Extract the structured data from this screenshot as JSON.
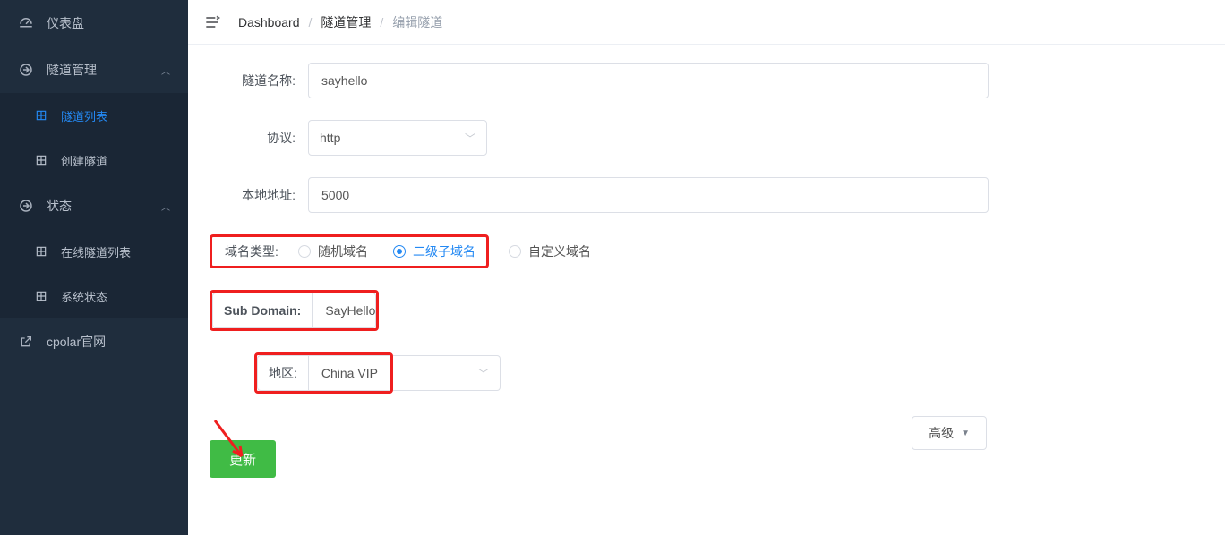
{
  "sidebar": {
    "items": [
      {
        "icon": "dashboard-icon",
        "label": "仪表盘",
        "type": "item"
      },
      {
        "icon": "circle-arrow-icon",
        "label": "隧道管理",
        "type": "group",
        "expanded": true,
        "children": [
          {
            "icon": "grid-icon",
            "label": "隧道列表",
            "active": true
          },
          {
            "icon": "grid-icon",
            "label": "创建隧道",
            "active": false
          }
        ]
      },
      {
        "icon": "circle-arrow-icon",
        "label": "状态",
        "type": "group",
        "expanded": true,
        "children": [
          {
            "icon": "grid-icon",
            "label": "在线隧道列表",
            "active": false
          },
          {
            "icon": "grid-icon",
            "label": "系统状态",
            "active": false
          }
        ]
      },
      {
        "icon": "external-link-icon",
        "label": "cpolar官网",
        "type": "item"
      }
    ]
  },
  "breadcrumb": {
    "items": [
      {
        "label": "Dashboard",
        "link": true
      },
      {
        "label": "隧道管理",
        "link": true
      },
      {
        "label": "编辑隧道",
        "link": false
      }
    ],
    "separator": "/"
  },
  "form": {
    "tunnel_name": {
      "label": "隧道名称:",
      "value": "sayhello"
    },
    "protocol": {
      "label": "协议:",
      "value": "http"
    },
    "local_addr": {
      "label": "本地地址:",
      "value": "5000"
    },
    "domain_type": {
      "label": "域名类型:",
      "options": [
        {
          "key": "random",
          "label": "随机域名",
          "selected": false
        },
        {
          "key": "subdomain",
          "label": "二级子域名",
          "selected": true
        },
        {
          "key": "custom",
          "label": "自定义域名",
          "selected": false
        }
      ]
    },
    "subdomain": {
      "label": "Sub Domain:",
      "value": "SayHello"
    },
    "region": {
      "label": "地区:",
      "value": "China VIP"
    },
    "advanced_label": "高级",
    "update_label": "更新"
  }
}
